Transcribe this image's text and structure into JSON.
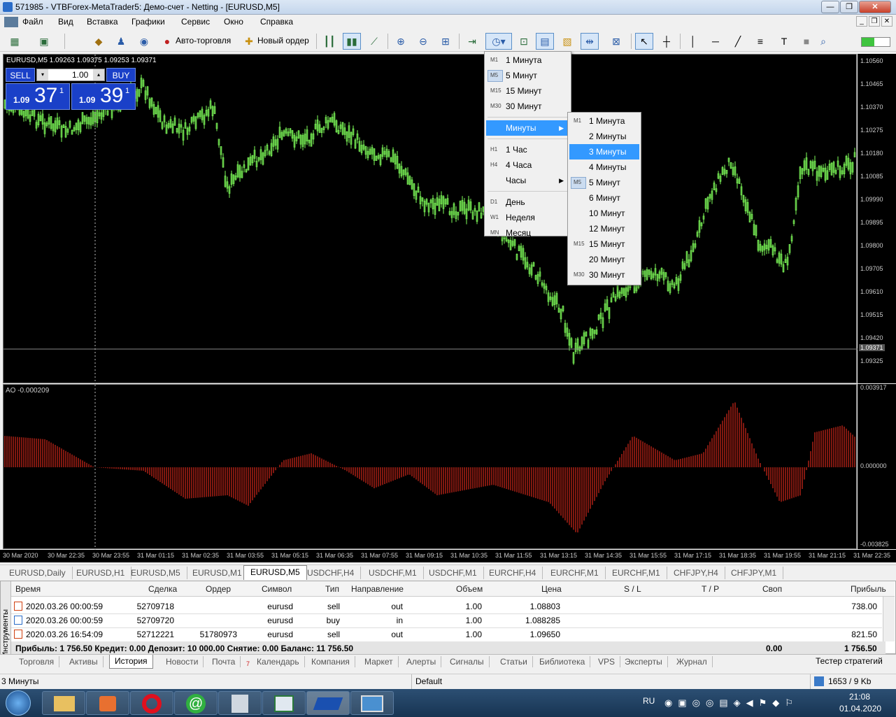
{
  "window": {
    "title": "571985 - VTBForex-MetaTrader5: Демо-счет - Netting - [EURUSD,M5]"
  },
  "menu": [
    "Файл",
    "Вид",
    "Вставка",
    "Графики",
    "Сервис",
    "Окно",
    "Справка"
  ],
  "toolbar": {
    "autotrading": "Авто-торговля",
    "new_order": "Новый ордер",
    "alerts_count": "1"
  },
  "chart": {
    "symbol_info": "EURUSD,M5  1.09263 1.09375 1.09253 1.09371",
    "current_price": "1.09371",
    "price_ticks": [
      "1.10560",
      "1.10465",
      "1.10370",
      "1.10275",
      "1.10180",
      "1.10085",
      "1.09990",
      "1.09895",
      "1.09800",
      "1.09705",
      "1.09610",
      "1.09515",
      "1.09420",
      "1.09325"
    ],
    "indicator_label": "AO -0.000209",
    "indicator_ticks": [
      "0.003917",
      "0.000000",
      "-0.003825"
    ],
    "time_ticks": [
      "30 Mar 2020",
      "30 Mar 22:35",
      "30 Mar 23:55",
      "31 Mar 01:15",
      "31 Mar 02:35",
      "31 Mar 03:55",
      "31 Mar 05:15",
      "31 Mar 06:35",
      "31 Mar 07:55",
      "31 Mar 09:15",
      "31 Mar 10:35",
      "31 Mar 11:55",
      "31 Mar 13:15",
      "31 Mar 14:35",
      "31 Mar 15:55",
      "31 Mar 17:15",
      "31 Mar 18:35",
      "31 Mar 19:55",
      "31 Mar 21:15",
      "31 Mar 22:35"
    ],
    "colors": {
      "bull": "#7fff5a",
      "bear": "#ff3020",
      "bg": "#000000"
    }
  },
  "trade": {
    "sell": "SELL",
    "buy": "BUY",
    "volume": "1.00",
    "sell_prefix": "1.09",
    "sell_big": "37",
    "sell_sup": "1",
    "buy_prefix": "1.09",
    "buy_big": "39",
    "buy_sup": "1"
  },
  "timeframe_menu": [
    {
      "icon": "M1",
      "label": "1 Минута"
    },
    {
      "icon": "M5",
      "label": "5 Минут"
    },
    {
      "icon": "M15",
      "label": "15 Минут"
    },
    {
      "icon": "M30",
      "label": "30 Минут"
    },
    {
      "icon": "",
      "label": "Минуты"
    },
    {
      "icon": "H1",
      "label": "1 Час"
    },
    {
      "icon": "H4",
      "label": "4 Часа"
    },
    {
      "icon": "",
      "label": "Часы"
    },
    {
      "icon": "D1",
      "label": "День"
    },
    {
      "icon": "W1",
      "label": "Неделя"
    },
    {
      "icon": "MN",
      "label": "Месяц"
    }
  ],
  "minutes_submenu": [
    {
      "icon": "M1",
      "label": "1 Минута"
    },
    {
      "icon": "",
      "label": "2 Минуты"
    },
    {
      "icon": "",
      "label": "3 Минуты"
    },
    {
      "icon": "",
      "label": "4 Минуты"
    },
    {
      "icon": "M5",
      "label": "5 Минут"
    },
    {
      "icon": "",
      "label": "6 Минут"
    },
    {
      "icon": "",
      "label": "10 Минут"
    },
    {
      "icon": "",
      "label": "12 Минут"
    },
    {
      "icon": "M15",
      "label": "15 Минут"
    },
    {
      "icon": "",
      "label": "20 Минут"
    },
    {
      "icon": "M30",
      "label": "30 Минут"
    }
  ],
  "chart_tabs": [
    "EURUSD,Daily",
    "EURUSD,H1",
    "EURUSD,M5",
    "EURUSD,M1",
    "EURUSD,M5",
    "USDCHF,H4",
    "USDCHF,M1",
    "USDCHF,M1",
    "EURCHF,H4",
    "EURCHF,M1",
    "EURCHF,M1",
    "CHFJPY,H4",
    "CHFJPY,M1"
  ],
  "history": {
    "side_label": "Инструменты",
    "headers": [
      "Время",
      "Сделка",
      "Ордер",
      "Символ",
      "Тип",
      "Направление",
      "Объем",
      "Цена",
      "S / L",
      "T / P",
      "Своп",
      "Прибыль"
    ],
    "rows": [
      [
        "2020.03.26 00:00:59",
        "52709718",
        "",
        "eurusd",
        "sell",
        "out",
        "1.00",
        "1.08803",
        "",
        "",
        "",
        "738.00"
      ],
      [
        "2020.03.26 00:00:59",
        "52709720",
        "",
        "eurusd",
        "buy",
        "in",
        "1.00",
        "1.088285",
        "",
        "",
        "",
        ""
      ],
      [
        "2020.03.26 16:54:09",
        "52712221",
        "51780973",
        "eurusd",
        "sell",
        "out",
        "1.00",
        "1.09650",
        "",
        "",
        "",
        "821.50"
      ]
    ],
    "summary": "Прибыль: 1 756.50  Кредит: 0.00  Депозит: 10 000.00  Снятие: 0.00  Баланс: 11 756.50",
    "summary_swap": "0.00",
    "summary_profit": "1 756.50"
  },
  "bottom_tabs": [
    "Торговля",
    "Активы",
    "История",
    "Новости",
    "Почта",
    "Календарь",
    "Компания",
    "Маркет",
    "Алерты",
    "Сигналы",
    "Статьи",
    "Библиотека",
    "VPS",
    "Эксперты",
    "Журнал"
  ],
  "mail_count": "7",
  "strategy_tester": "Тестер стратегий",
  "status": {
    "left": "3 Минуты",
    "center": "Default",
    "right": "1653 / 9 Kb"
  },
  "taskbar": {
    "lang": "RU",
    "time": "21:08",
    "date": "01.04.2020"
  }
}
